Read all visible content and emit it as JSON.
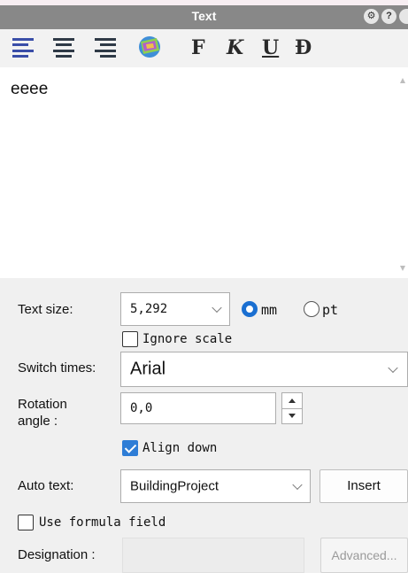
{
  "window": {
    "title": "Text",
    "title_icons": [
      "gear-icon",
      "help-icon",
      "close-icon"
    ]
  },
  "toolbar": {
    "tools": [
      "align-left-icon",
      "align-center-icon",
      "align-right-icon",
      "text-style-icon"
    ],
    "bold": "F",
    "italic": "K",
    "underline": "U",
    "strike": "Đ"
  },
  "text_content": "eeee",
  "form": {
    "text_size_label": "Text size:",
    "text_size_value": "5,292",
    "unit_mm": "mm",
    "unit_pt": "pt",
    "unit_selected": "mm",
    "ignore_scale_label": "Ignore scale",
    "ignore_scale_checked": false,
    "font_label": "Switch times:",
    "font_value": "Arial",
    "rotation_label_1": "Rotation",
    "rotation_label_2": "angle :",
    "rotation_value": "0,0",
    "align_down_label": "Align down",
    "align_down_checked": true,
    "auto_text_label": "Auto text:",
    "auto_text_value": "BuildingProject",
    "insert_label": "Insert",
    "use_formula_label": "Use formula field",
    "use_formula_checked": false,
    "designation_label": "Designation :",
    "designation_value": "",
    "advanced_label": "Advanced..."
  },
  "colors": {
    "titlebar": "#888888",
    "accent": "#1a6fd1",
    "panel": "#f0f0f0"
  }
}
